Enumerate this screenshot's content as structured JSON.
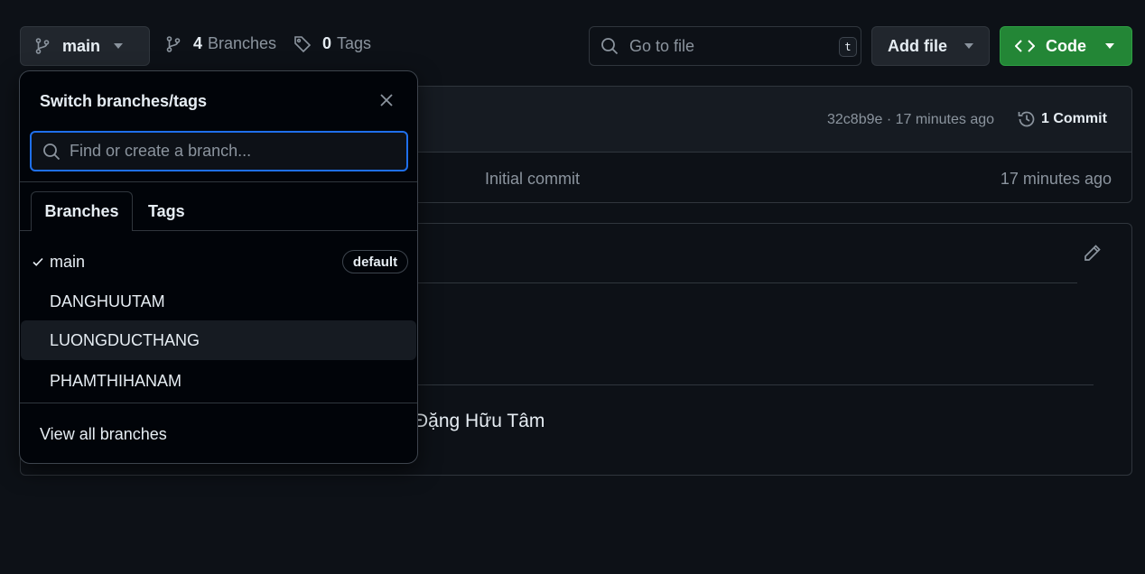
{
  "toolbar": {
    "branch_label": "main",
    "branches_count": "4",
    "branches_label": "Branches",
    "tags_count": "0",
    "tags_label": "Tags",
    "goto_placeholder": "Go to file",
    "goto_shortcut": "t",
    "add_file_label": "Add file",
    "code_label": "Code",
    "accent_color": "#238636"
  },
  "files": {
    "commit_meta": "32c8b9e · 17 minutes ago",
    "commits_label": "1 Commit",
    "rows": [
      {
        "message": "Initial commit",
        "time": "17 minutes ago"
      }
    ]
  },
  "readme": {
    "author_line": "Đặng Hữu Tâm"
  },
  "branch_menu": {
    "title": "Switch branches/tags",
    "filter_placeholder": "Find or create a branch...",
    "tabs": [
      "Branches",
      "Tags"
    ],
    "active_tab": "Branches",
    "branches": [
      {
        "name": "main",
        "badge": "default",
        "selected": true
      },
      {
        "name": "DANGHUUTAM"
      },
      {
        "name": "LUONGDUCTHANG",
        "hovered": true
      },
      {
        "name": "PHAMTHIHANAM"
      }
    ],
    "view_all_label": "View all branches",
    "focus_color": "#1f6feb"
  }
}
